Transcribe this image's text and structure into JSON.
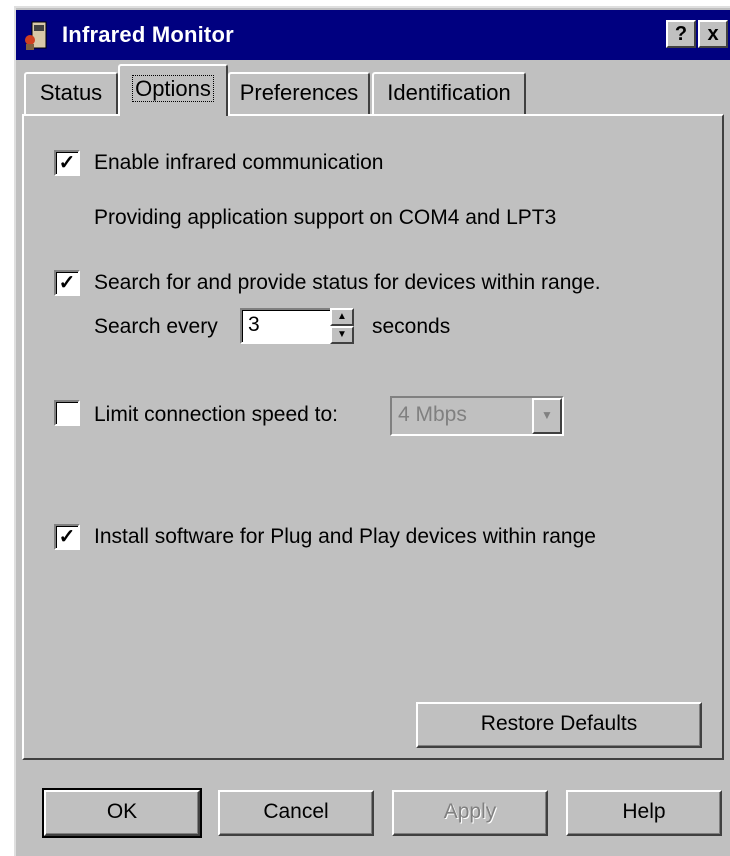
{
  "window": {
    "title": "Infrared Monitor",
    "help_btn": "?",
    "close_btn": "x"
  },
  "tabs": [
    {
      "label": "Status"
    },
    {
      "label": "Options"
    },
    {
      "label": "Preferences"
    },
    {
      "label": "Identification"
    }
  ],
  "options": {
    "enable_ir": {
      "checked": true,
      "label": "Enable infrared communication"
    },
    "support_text": "Providing application support on COM4 and LPT3",
    "search_devices": {
      "checked": true,
      "label": "Search for and provide status for devices within range."
    },
    "search_every_label": "Search every",
    "search_every_value": "3",
    "seconds_label": "seconds",
    "limit_speed": {
      "checked": false,
      "label": "Limit connection speed to:"
    },
    "speed_value": "4 Mbps",
    "install_pnp": {
      "checked": true,
      "label": "Install software for Plug and Play devices within range"
    },
    "restore_defaults": "Restore Defaults"
  },
  "buttons": {
    "ok": "OK",
    "cancel": "Cancel",
    "apply": "Apply",
    "help": "Help"
  },
  "glyphs": {
    "check": "✓",
    "up": "▲",
    "down": "▼"
  }
}
